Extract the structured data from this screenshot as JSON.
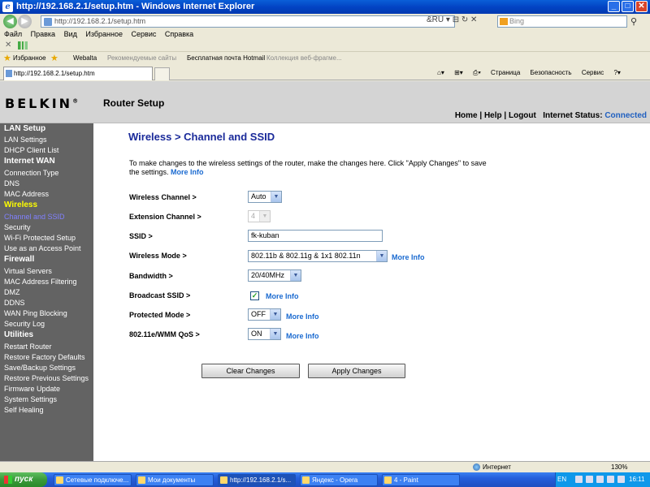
{
  "window": {
    "title": "http://192.168.2.1/setup.htm - Windows Internet Explorer",
    "min": "_",
    "max": "□",
    "close": "✕"
  },
  "browser": {
    "address": "http://192.168.2.1/setup.htm",
    "search_placeholder": "Bing",
    "menu": [
      "Файл",
      "Правка",
      "Вид",
      "Избранное",
      "Сервис",
      "Справка"
    ],
    "favorites_label": "Избранное",
    "favorites": [
      "Webalta",
      "Рекомендуемые сайты",
      "Бесплатная почта Hotmail",
      "Коллекция веб-фрагме..."
    ],
    "tab_title": "http://192.168.2.1/setup.htm",
    "cmd": [
      "Страница",
      "Безопасность",
      "Сервис"
    ],
    "status_zone": "Интернет",
    "zoom": "130%"
  },
  "header": {
    "logo": "BELKIN",
    "logo_mark": "®",
    "title": "Router Setup",
    "nav_links": "Home | Help | Logout",
    "internet_status_label": "Internet Status:",
    "internet_status_value": "Connected",
    "status_color": "#2060c0"
  },
  "sidebar": {
    "items": [
      {
        "label": "LAN Setup",
        "type": "head"
      },
      {
        "label": "LAN Settings",
        "type": "link"
      },
      {
        "label": "DHCP Client List",
        "type": "link"
      },
      {
        "label": "Internet WAN",
        "type": "head"
      },
      {
        "label": "Connection Type",
        "type": "link"
      },
      {
        "label": "DNS",
        "type": "link"
      },
      {
        "label": "MAC Address",
        "type": "link"
      },
      {
        "label": "Wireless",
        "type": "head-selected"
      },
      {
        "label": "Channel and SSID",
        "type": "selected"
      },
      {
        "label": "Security",
        "type": "link"
      },
      {
        "label": "Wi-Fi Protected Setup",
        "type": "link"
      },
      {
        "label": "Use as an Access Point",
        "type": "link"
      },
      {
        "label": "Firewall",
        "type": "head"
      },
      {
        "label": "Virtual Servers",
        "type": "link"
      },
      {
        "label": "MAC Address Filtering",
        "type": "link"
      },
      {
        "label": "DMZ",
        "type": "link"
      },
      {
        "label": "DDNS",
        "type": "link"
      },
      {
        "label": "WAN Ping Blocking",
        "type": "link"
      },
      {
        "label": "Security Log",
        "type": "link"
      },
      {
        "label": "Utilities",
        "type": "head"
      },
      {
        "label": "Restart Router",
        "type": "link"
      },
      {
        "label": "Restore Factory Defaults",
        "type": "link"
      },
      {
        "label": "Save/Backup Settings",
        "type": "link"
      },
      {
        "label": "Restore Previous Settings",
        "type": "link"
      },
      {
        "label": "Firmware Update",
        "type": "link"
      },
      {
        "label": "System Settings",
        "type": "link"
      },
      {
        "label": "Self Healing",
        "type": "link"
      }
    ]
  },
  "main": {
    "title": "Wireless > Channel and SSID",
    "intro": "To make changes to the wireless settings of the router, make the changes here. Click \"Apply Changes\" to save the settings.",
    "more_info": "More Info",
    "fields": {
      "channel": {
        "label": "Wireless Channel >",
        "value": "Auto"
      },
      "ext_channel": {
        "label": "Extension Channel >",
        "value": "4"
      },
      "ssid": {
        "label": "SSID >",
        "value": "fk-kuban"
      },
      "mode": {
        "label": "Wireless Mode >",
        "value": "802.11b & 802.11g & 1x1 802.11n"
      },
      "bandwidth": {
        "label": "Bandwidth >",
        "value": "20/40MHz"
      },
      "broadcast": {
        "label": "Broadcast SSID >",
        "checked": true
      },
      "protected": {
        "label": "Protected Mode >",
        "value": "OFF"
      },
      "wmm": {
        "label": "802.11e/WMM QoS >",
        "value": "ON"
      }
    },
    "clear_button": "Clear Changes",
    "apply_button": "Apply Changes"
  },
  "taskbar": {
    "start": "пуск",
    "tasks": [
      "Сетевые подключе...",
      "Мои документы",
      "http://192.168.2.1/s...",
      "Яндекс - Opera",
      "4 - Paint"
    ],
    "lang": "EN",
    "clock": "16:11"
  }
}
